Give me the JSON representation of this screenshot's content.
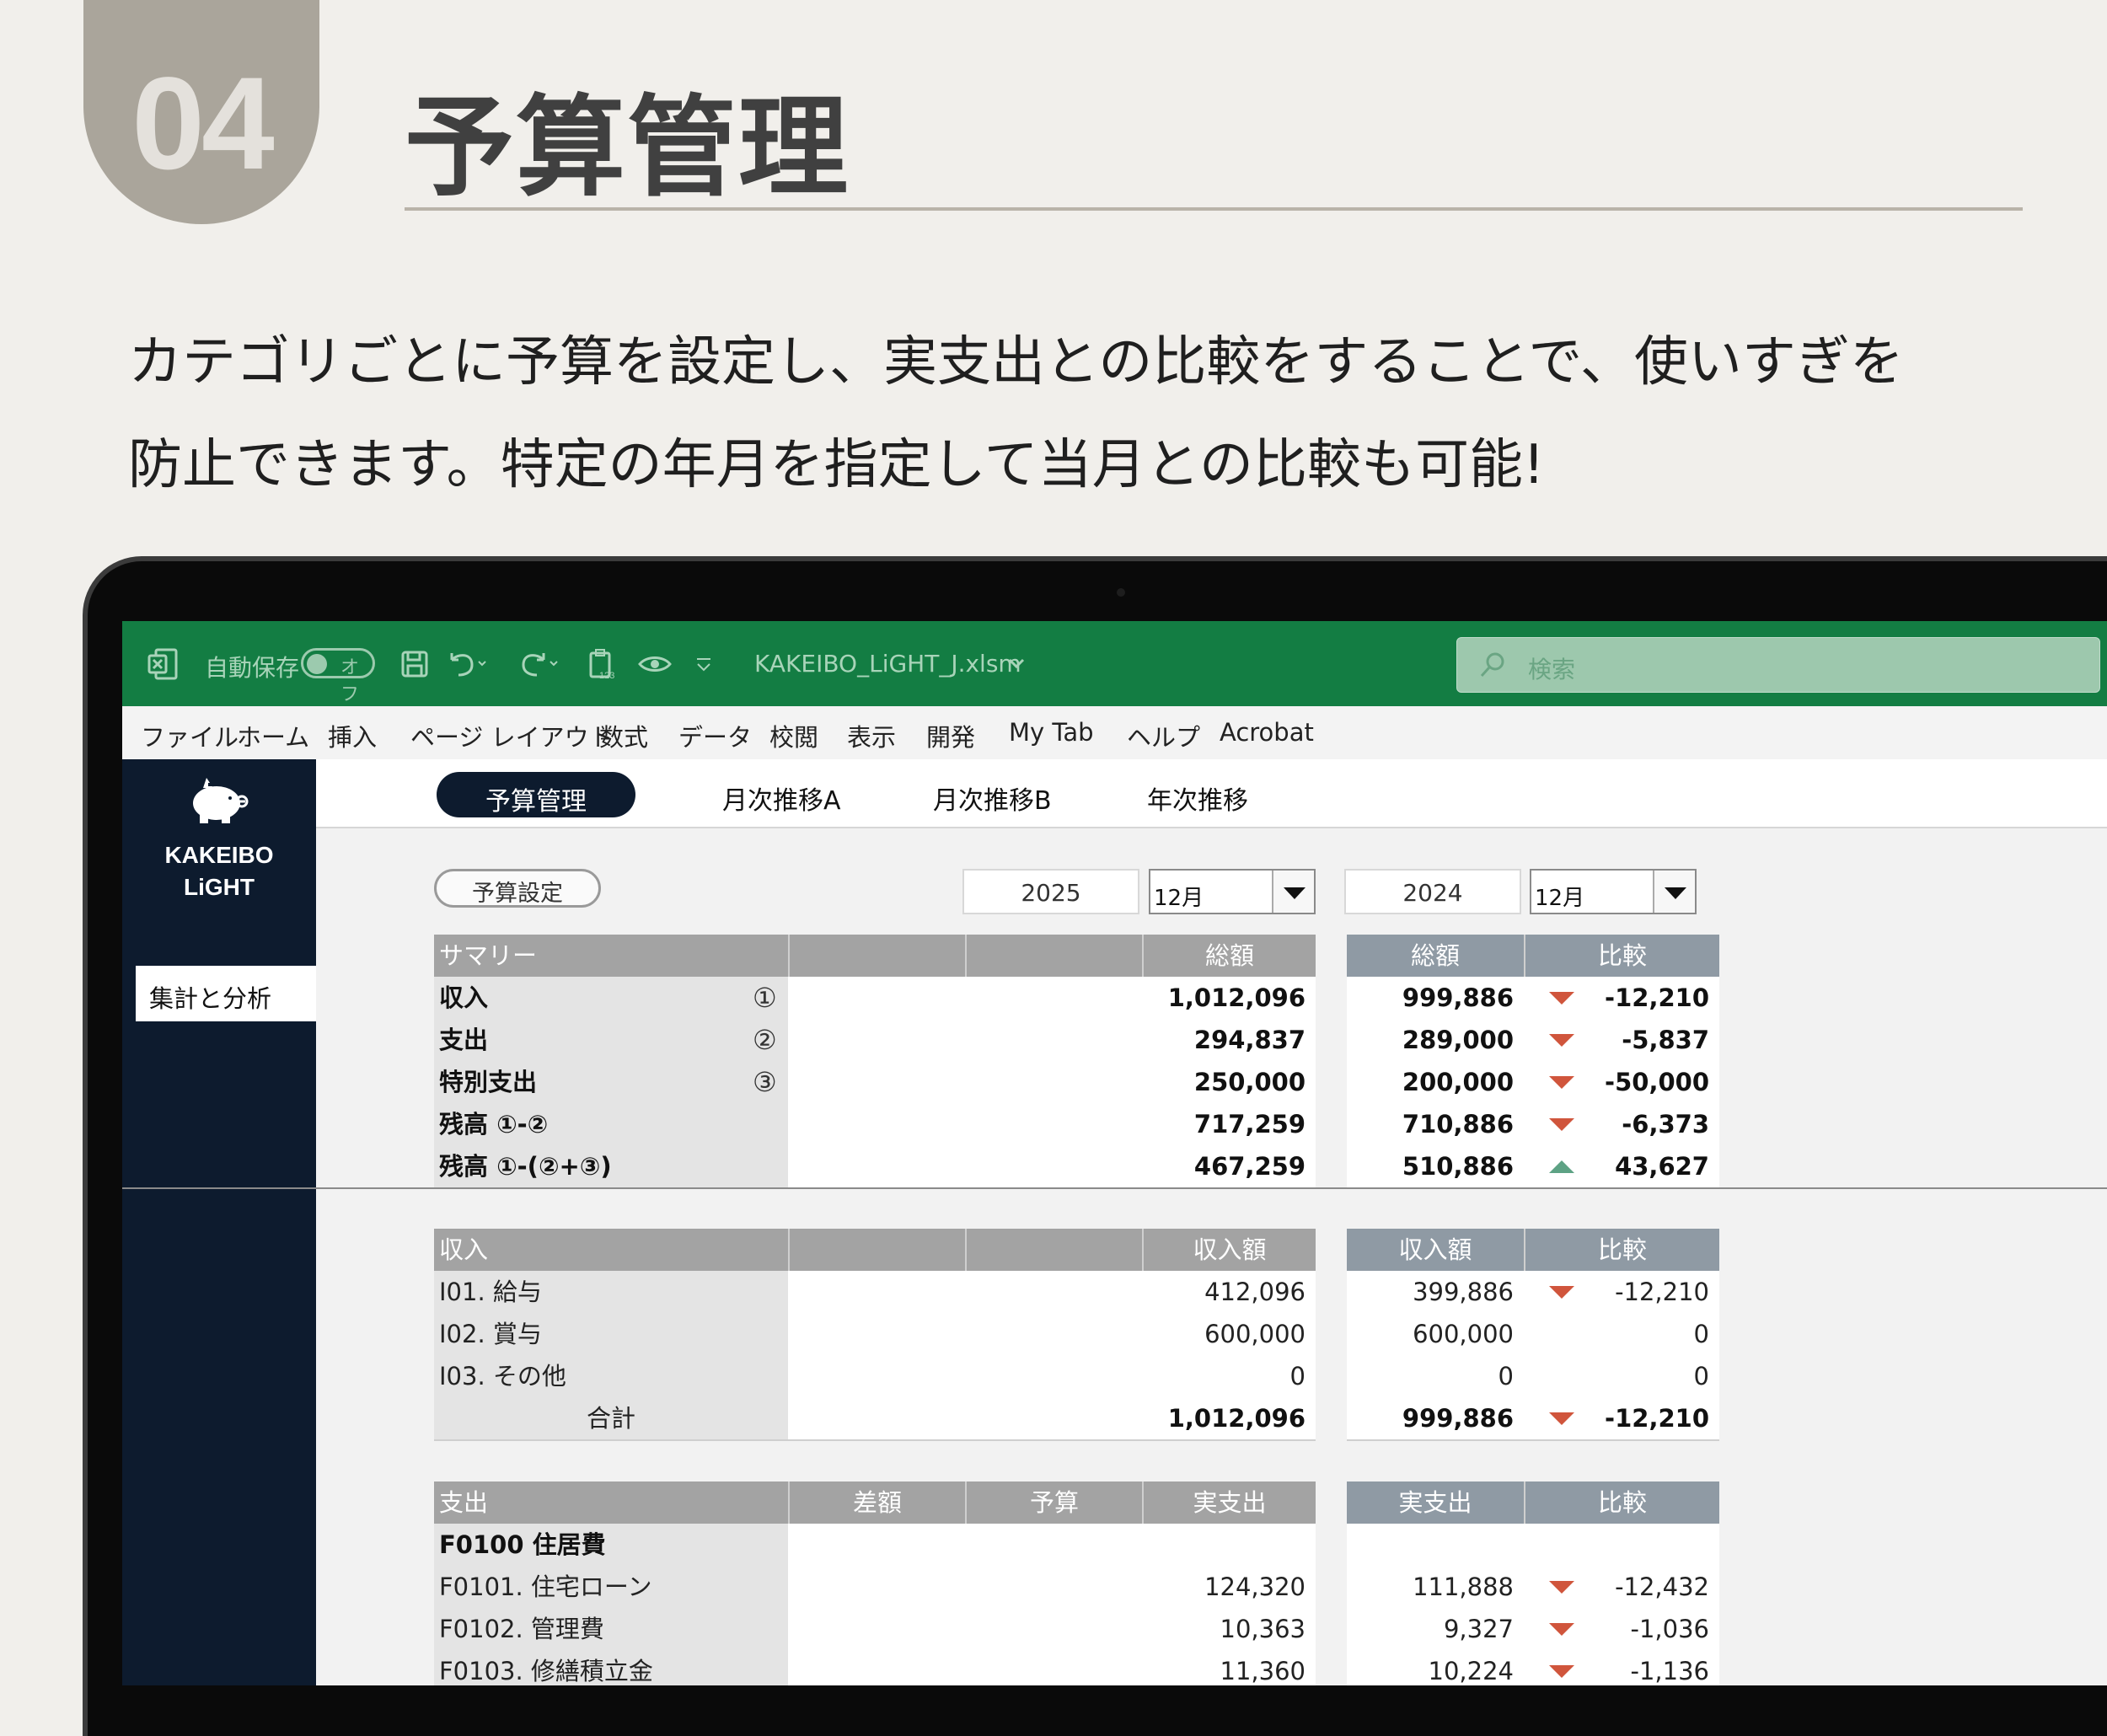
{
  "header": {
    "number": "04",
    "title": "予算管理",
    "description": [
      "カテゴリごとに予算を設定し、実支出との比較をすることで、使いすぎを",
      "防止できます。特定の年月を指定して当月との比較も可能!"
    ]
  },
  "excel": {
    "autosave_label": "自動保存",
    "autosave_state": "オフ",
    "filename": "KAKEIBO_LiGHT_J.xlsm",
    "search_placeholder": "検索",
    "menu": [
      "ファイル",
      "ホーム",
      "挿入",
      "ページ レイアウト",
      "数式",
      "データ",
      "校閲",
      "表示",
      "開発",
      "My Tab",
      "ヘルプ",
      "Acrobat"
    ],
    "brand_color": "#137d43"
  },
  "sidebar": {
    "logo_line1": "KAKEIBO",
    "logo_line2": "LiGHT",
    "button": "集計と分析"
  },
  "tabs": [
    "予算管理",
    "月次推移A",
    "月次推移B",
    "年次推移"
  ],
  "controls": {
    "budget_button": "予算設定",
    "year_current": "2025",
    "month_current": "12月",
    "year_compare": "2024",
    "month_compare": "12月"
  },
  "summary": {
    "headers": [
      "サマリー",
      "",
      "",
      "総額",
      "総額",
      "比較"
    ],
    "rows": [
      {
        "label": "収入",
        "marker": "①",
        "total": "1,012,096",
        "cmp_total": "999,886",
        "trend": "down",
        "diff": "-12,210"
      },
      {
        "label": "支出",
        "marker": "②",
        "total": "294,837",
        "cmp_total": "289,000",
        "trend": "down",
        "diff": "-5,837"
      },
      {
        "label": "特別支出",
        "marker": "③",
        "total": "250,000",
        "cmp_total": "200,000",
        "trend": "down",
        "diff": "-50,000"
      },
      {
        "label": "残高 ①-②",
        "marker": "",
        "total": "717,259",
        "cmp_total": "710,886",
        "trend": "down",
        "diff": "-6,373"
      },
      {
        "label": "残高 ①-(②+③)",
        "marker": "",
        "total": "467,259",
        "cmp_total": "510,886",
        "trend": "up",
        "diff": "43,627"
      }
    ]
  },
  "income": {
    "headers": [
      "収入",
      "",
      "",
      "収入額",
      "収入額",
      "比較"
    ],
    "rows": [
      {
        "label": "I01. 給与",
        "amount": "412,096",
        "cmp": "399,886",
        "trend": "down",
        "diff": "-12,210"
      },
      {
        "label": "I02. 賞与",
        "amount": "600,000",
        "cmp": "600,000",
        "trend": "",
        "diff": "0"
      },
      {
        "label": "I03. その他",
        "amount": "0",
        "cmp": "0",
        "trend": "",
        "diff": "0"
      }
    ],
    "total": {
      "label": "合計",
      "amount": "1,012,096",
      "cmp": "999,886",
      "trend": "down",
      "diff": "-12,210"
    }
  },
  "expense": {
    "headers": [
      "支出",
      "差額",
      "予算",
      "実支出",
      "実支出",
      "比較"
    ],
    "group": "F0100 住居費",
    "rows": [
      {
        "label": "F0101. 住宅ローン",
        "actual": "124,320",
        "cmp": "111,888",
        "trend": "down",
        "diff": "-12,432"
      },
      {
        "label": "F0102. 管理費",
        "actual": "10,363",
        "cmp": "9,327",
        "trend": "down",
        "diff": "-1,036"
      },
      {
        "label": "F0103. 修繕積立金",
        "actual": "11,360",
        "cmp": "10,224",
        "trend": "down",
        "diff": "-1,136"
      }
    ]
  }
}
